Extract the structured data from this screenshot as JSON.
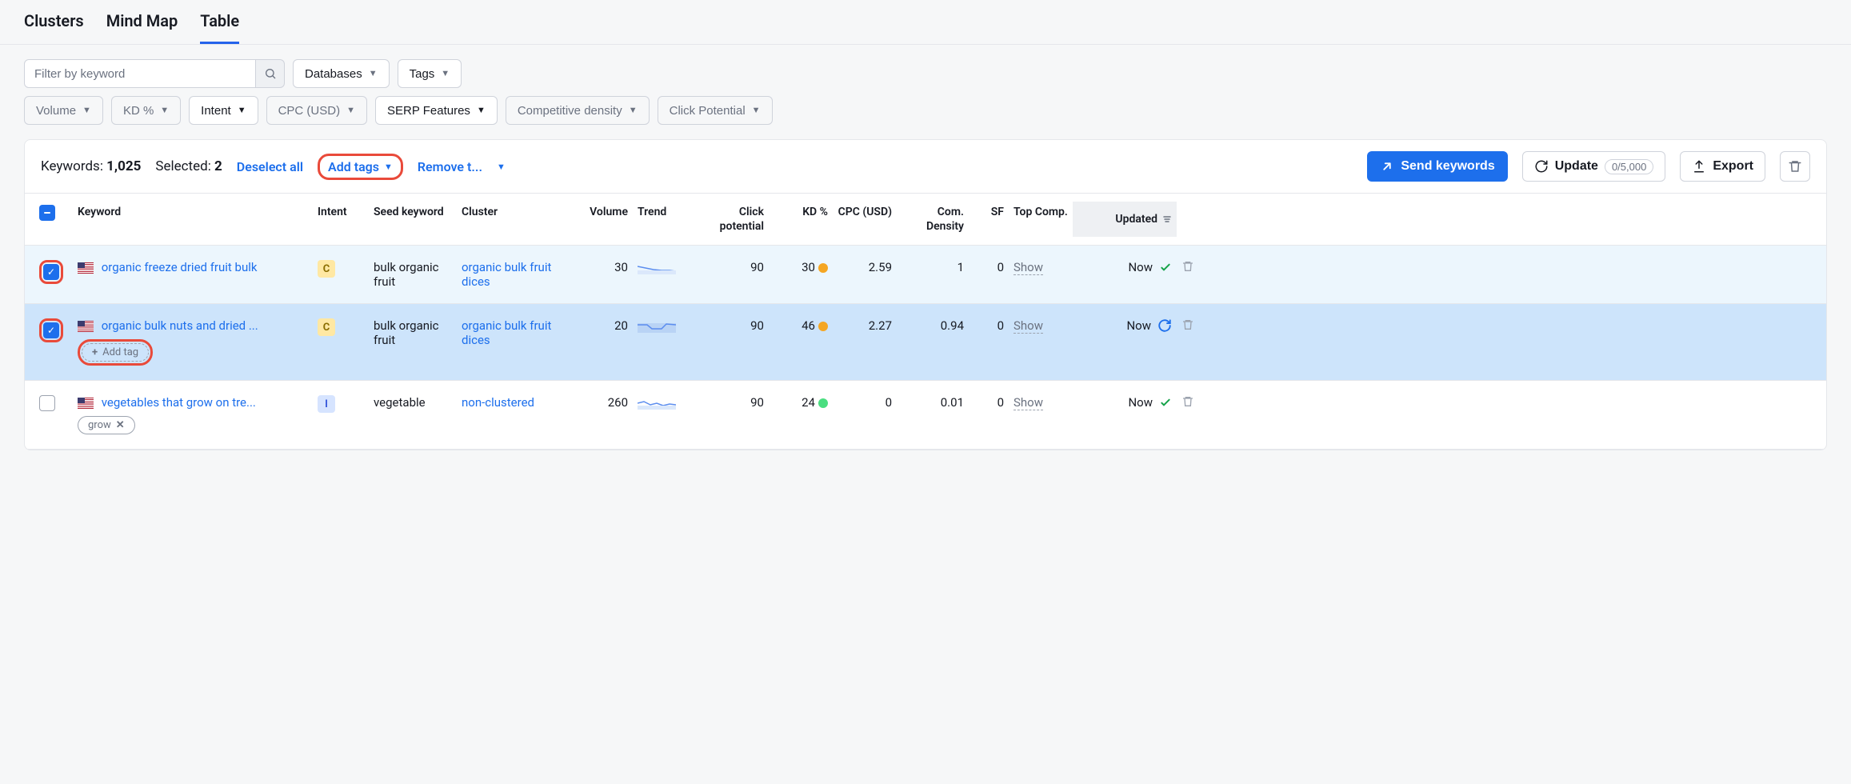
{
  "tabs": {
    "clusters": "Clusters",
    "mindmap": "Mind Map",
    "table": "Table"
  },
  "filters": {
    "search_placeholder": "Filter by keyword",
    "databases": "Databases",
    "tags": "Tags",
    "volume": "Volume",
    "kd": "KD %",
    "intent": "Intent",
    "cpc": "CPC (USD)",
    "serp": "SERP Features",
    "comp": "Competitive density",
    "click": "Click Potential"
  },
  "actionbar": {
    "keywords_label": "Keywords:",
    "keywords_count": "1,025",
    "selected_label": "Selected:",
    "selected_count": "2",
    "deselect": "Deselect all",
    "add_tags": "Add tags",
    "remove_t": "Remove t...",
    "send": "Send keywords",
    "update": "Update",
    "update_count": "0/5,000",
    "export": "Export"
  },
  "columns": {
    "keyword": "Keyword",
    "intent": "Intent",
    "seed": "Seed keyword",
    "cluster": "Cluster",
    "volume": "Volume",
    "trend": "Trend",
    "clickp": "Click potential",
    "kd": "KD %",
    "cpc": "CPC (USD)",
    "comd": "Com. Density",
    "sf": "SF",
    "top": "Top Comp.",
    "updated": "Updated"
  },
  "rows": [
    {
      "keyword": "organic freeze dried fruit bulk",
      "intent": "C",
      "seed": "bulk organic fruit",
      "cluster": "organic bulk fruit dices",
      "volume": "30",
      "clickp": "90",
      "kd": "30",
      "cpc": "2.59",
      "comd": "1",
      "sf": "0",
      "top": "Show",
      "updated": "Now"
    },
    {
      "keyword": "organic bulk nuts and dried ...",
      "intent": "C",
      "seed": "bulk organic fruit",
      "cluster": "organic bulk fruit dices",
      "volume": "20",
      "clickp": "90",
      "kd": "46",
      "cpc": "2.27",
      "comd": "0.94",
      "sf": "0",
      "top": "Show",
      "updated": "Now",
      "add_tag": "Add tag"
    },
    {
      "keyword": "vegetables that grow on tre...",
      "intent": "I",
      "seed": "vegetable",
      "cluster": "non-clustered",
      "volume": "260",
      "clickp": "90",
      "kd": "24",
      "cpc": "0",
      "comd": "0.01",
      "sf": "0",
      "top": "Show",
      "updated": "Now",
      "tag": "grow"
    }
  ]
}
